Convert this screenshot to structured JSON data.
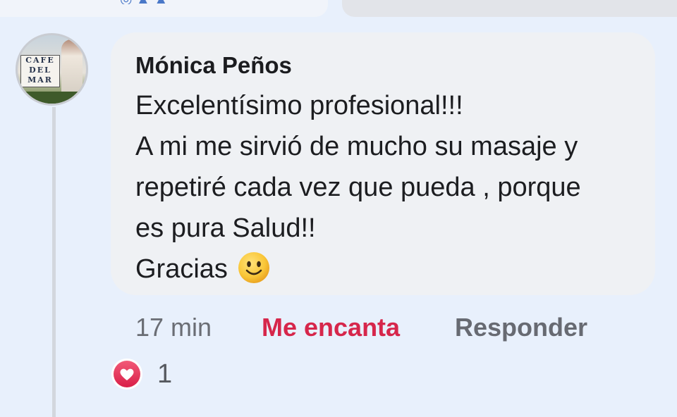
{
  "comment": {
    "author": "Mónica Peños",
    "lines": [
      "Excelentísimo profesional!!!",
      "A mi me sirvió de mucho su masaje y",
      "repetiré cada vez que pueda , porque",
      "es pura Salud!!",
      "Gracias"
    ],
    "emoji": "slightly-smiling-face",
    "time": "17 min",
    "love_label": "Me encanta",
    "reply_label": "Responder"
  },
  "reactions": {
    "icon": "heart-icon",
    "count": "1"
  },
  "avatar": {
    "sign_lines": [
      "CAFE",
      "DEL",
      "MAR"
    ]
  },
  "colors": {
    "background": "#e8f0fc",
    "bubble": "#eff1f4",
    "love": "#d6264b",
    "heart": "#e0395a"
  }
}
